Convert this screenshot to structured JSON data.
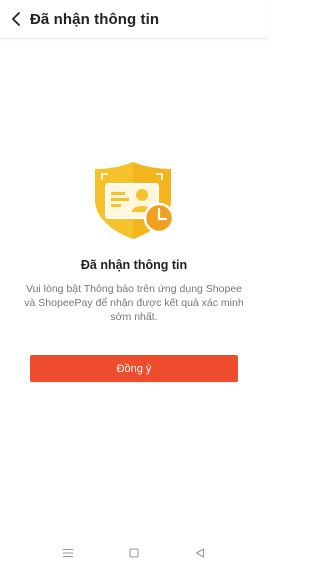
{
  "header": {
    "title": "Đã nhận thông tin",
    "back_icon": "chevron-left-icon"
  },
  "main": {
    "illustration_icon": "shield-id-card-clock-icon",
    "heading": "Đã nhận thông tin",
    "description": "Vui lòng bật Thông báo trên ứng dụng Shopee và ShopeePay để nhận được kết quả xác minh sớm nhất.",
    "confirm_label": "Đồng ý"
  },
  "navbar": {
    "items": [
      "menu-icon",
      "home-square-icon",
      "back-triangle-icon"
    ]
  },
  "colors": {
    "accent": "#ee4d2d",
    "shield": "#f6c22c",
    "clock": "#f0a020"
  }
}
